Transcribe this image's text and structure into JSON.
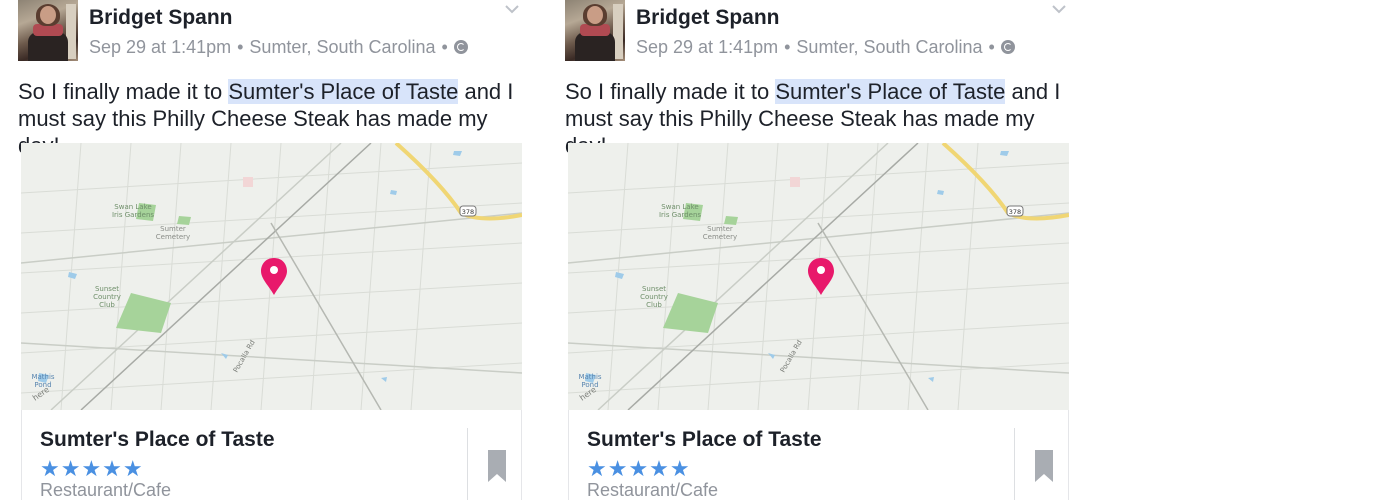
{
  "posts": [
    {
      "author": "Bridget Spann",
      "timestamp": "Sep 29 at 1:41pm",
      "location": "Sumter, South Carolina",
      "privacy_icon": "globe-icon",
      "text_before": "So I finally made it to ",
      "text_link": "Sumter's Place of Taste",
      "text_after": " and I must say this Philly Cheese Steak has made my day!",
      "map": {
        "labels": [
          "Swan Lake",
          "Iris Gardens",
          "Sumter",
          "Cemetery",
          "Sunset",
          "Country",
          "Club",
          "Pocalla Rd",
          "Mathis",
          "Pond",
          "here",
          "378"
        ]
      },
      "place": {
        "name": "Sumter's Place of Taste",
        "stars": "★★★★★",
        "rating": 5,
        "category": "Restaurant/Cafe"
      }
    },
    {
      "author": "Bridget Spann",
      "timestamp": "Sep 29 at 1:41pm",
      "location": "Sumter, South Carolina",
      "privacy_icon": "globe-icon",
      "text_before": "So I finally made it to ",
      "text_link": "Sumter's Place of Taste",
      "text_after": " and I must say this Philly Cheese Steak has made my day!",
      "map": {
        "labels": [
          "Swan Lake",
          "Iris Gardens",
          "Sumter",
          "Cemetery",
          "Sunset",
          "Country",
          "Club",
          "Pocalla Rd",
          "Mathis",
          "Pond",
          "here",
          "378"
        ]
      },
      "place": {
        "name": "Sumter's Place of Taste",
        "stars": "★★★★★",
        "rating": 5,
        "category": "Restaurant/Cafe"
      }
    }
  ],
  "meta_separator": "•",
  "colors": {
    "link_highlight": "#d8e4fa",
    "star_blue": "#4a90e2",
    "pin_pink": "#e8196b",
    "muted_text": "#90949c"
  }
}
